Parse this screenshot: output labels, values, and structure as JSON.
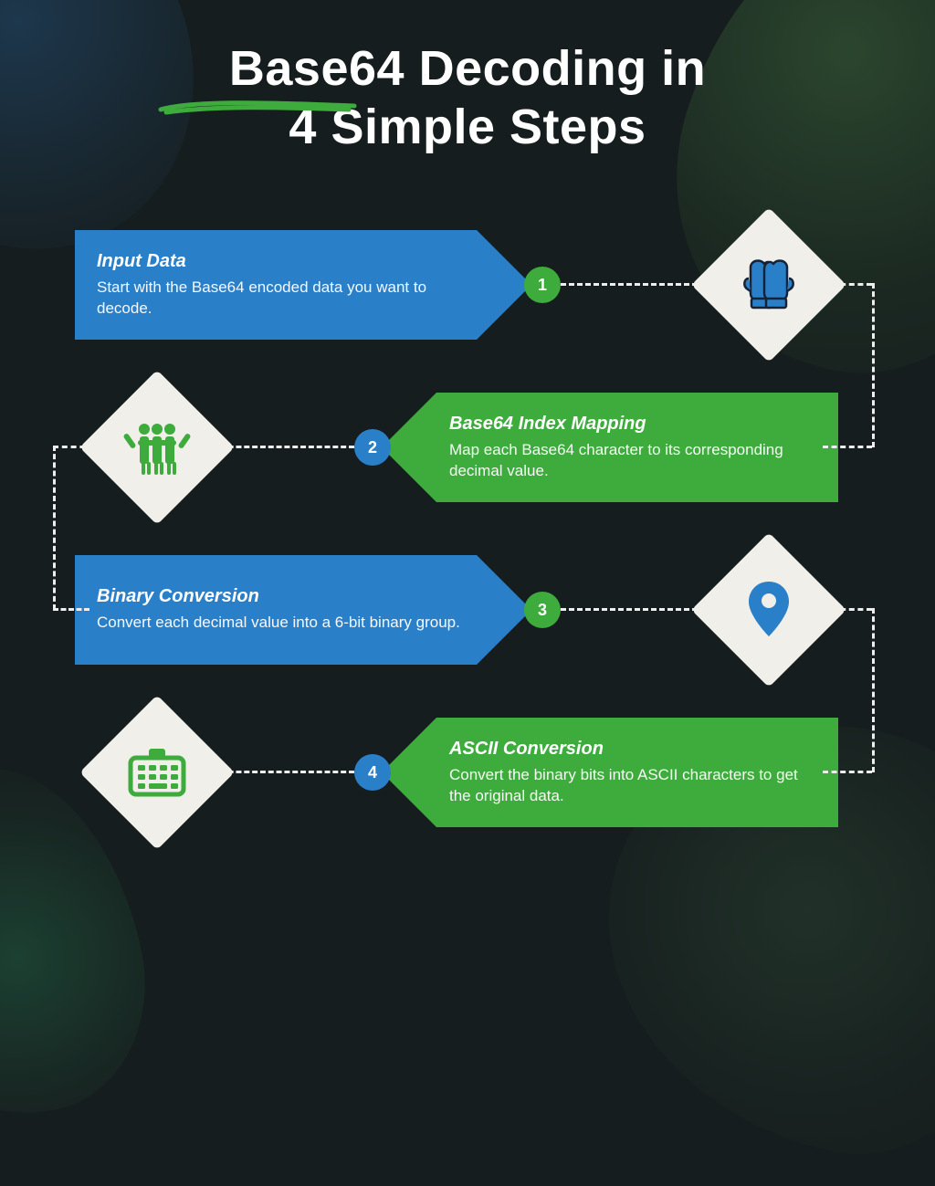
{
  "title_line1": "Base64 Decoding in",
  "title_line2": "4 Simple Steps",
  "colors": {
    "blue": "#2a7fc9",
    "green": "#3eab3d",
    "underline": "#3eab3d",
    "diamond_bg": "#f0efea",
    "dash": "#eeeeee"
  },
  "steps": [
    {
      "number": "1",
      "title": "Input Data",
      "description": "Start with the Base64 encoded data you want to decode.",
      "card_color": "blue",
      "badge_color": "green",
      "icon": "mittens-icon"
    },
    {
      "number": "2",
      "title": "Base64 Index Mapping",
      "description": "Map each Base64 character to its corresponding decimal value.",
      "card_color": "green",
      "badge_color": "blue",
      "icon": "people-group-icon"
    },
    {
      "number": "3",
      "title": "Binary Conversion",
      "description": "Convert each decimal value into a 6-bit binary group.",
      "card_color": "blue",
      "badge_color": "green",
      "icon": "location-pin-icon"
    },
    {
      "number": "4",
      "title": "ASCII Conversion",
      "description": "Convert the binary bits into ASCII characters to get the original data.",
      "card_color": "green",
      "badge_color": "blue",
      "icon": "keyboard-icon"
    }
  ]
}
